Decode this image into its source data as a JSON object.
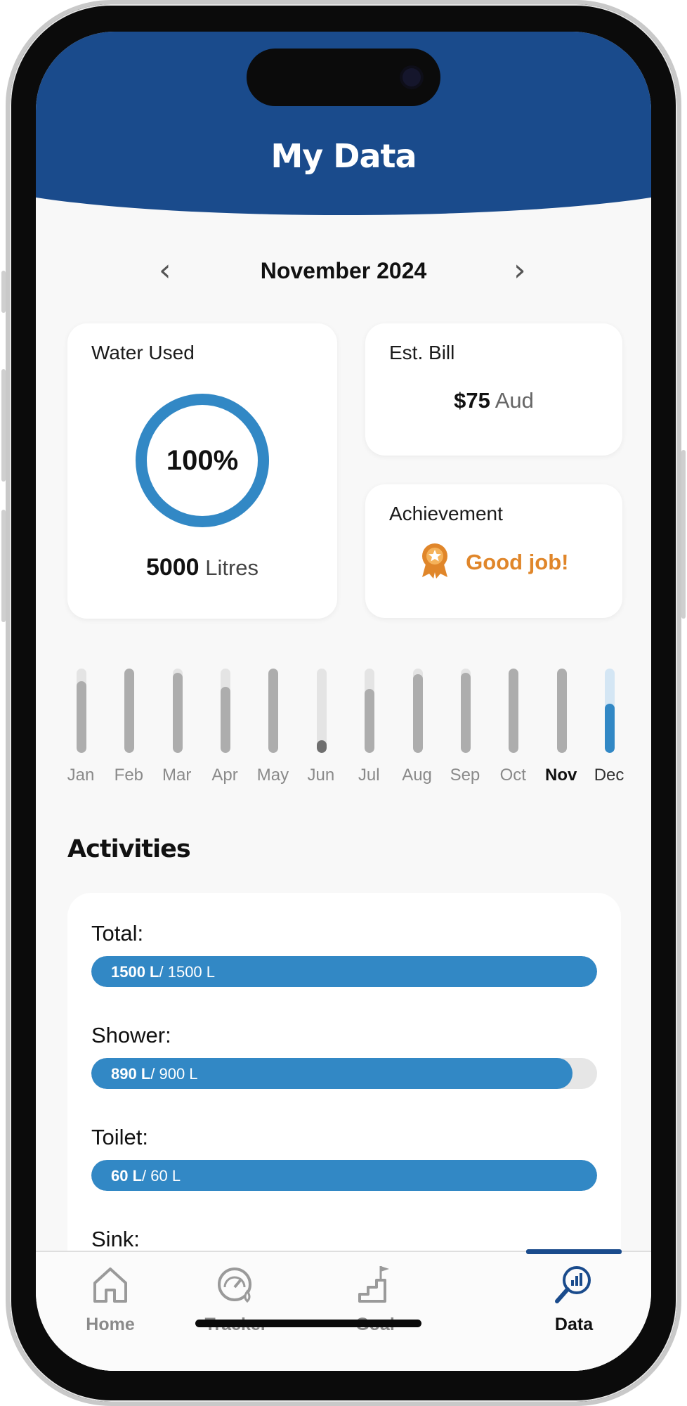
{
  "header": {
    "title": "My Data"
  },
  "month_nav": {
    "prev_icon": "‹",
    "label": "November 2024",
    "next_icon": "›"
  },
  "water_used": {
    "label": "Water Used",
    "percent": "100%",
    "amount": "5000",
    "unit": "Litres",
    "ring_color": "#3288c5"
  },
  "est_bill": {
    "label": "Est. Bill",
    "amount": "$75",
    "currency": "Aud"
  },
  "achievement": {
    "label": "Achievement",
    "text": "Good job!",
    "icon": "medal-icon",
    "color": "#e0862a"
  },
  "months": [
    {
      "label": "Jan",
      "level": 0.85
    },
    {
      "label": "Feb",
      "level": 1.0
    },
    {
      "label": "Mar",
      "level": 0.95
    },
    {
      "label": "Apr",
      "level": 0.78
    },
    {
      "label": "May",
      "level": 1.0
    },
    {
      "label": "Jun",
      "level": 0.15,
      "dark": true
    },
    {
      "label": "Jul",
      "level": 0.76
    },
    {
      "label": "Aug",
      "level": 0.93
    },
    {
      "label": "Sep",
      "level": 0.95
    },
    {
      "label": "Oct",
      "level": 1.0
    },
    {
      "label": "Nov",
      "level": 1.0,
      "selected": true
    },
    {
      "label": "Dec",
      "level": 0.58,
      "accent": true
    }
  ],
  "activities": {
    "title": "Activities",
    "items": [
      {
        "label": "Total:",
        "used": "1500 L",
        "limit": "/ 1500 L",
        "fraction": 1.0
      },
      {
        "label": "Shower:",
        "used": "890 L",
        "limit": "/ 900 L",
        "fraction": 0.952
      },
      {
        "label": "Toilet:",
        "used": "60 L",
        "limit": "/ 60 L",
        "fraction": 1.0
      },
      {
        "label": "Sink:",
        "used": "",
        "limit": "",
        "fraction": 0
      }
    ]
  },
  "tabbar": {
    "items": [
      {
        "label": "Home",
        "icon": "home-icon"
      },
      {
        "label": "Tracker",
        "icon": "gauge-icon"
      },
      {
        "label": "Goal",
        "icon": "goal-stairs-icon"
      },
      {
        "label": "Data",
        "icon": "data-search-icon",
        "active": true
      }
    ]
  },
  "colors": {
    "brand": "#1a4b8c",
    "accent": "#3288c5"
  }
}
